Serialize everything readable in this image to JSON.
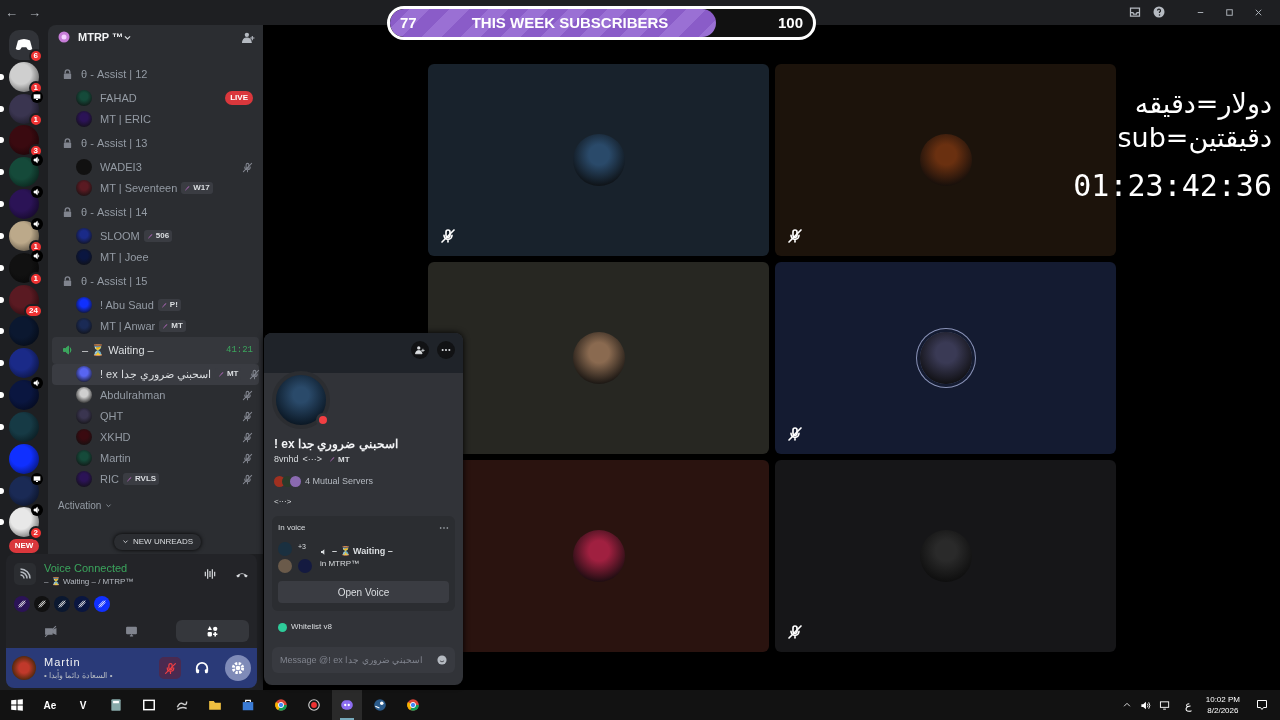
{
  "titlebar": {
    "back": "←",
    "forward": "→"
  },
  "subscriber_goal": {
    "current": "77",
    "label": "THIS WEEK SUBSCRIBERS",
    "target": "100",
    "level": 0.77
  },
  "servers": [
    {
      "kind": "home",
      "badge": "6",
      "unread": false,
      "voice": false,
      "screen": false
    },
    {
      "kind": "server",
      "badge": "1",
      "unread": true,
      "voice": false,
      "screen": false
    },
    {
      "kind": "server",
      "badge": "1",
      "unread": true,
      "voice": false,
      "screen": true
    },
    {
      "kind": "server",
      "badge": "3",
      "unread": true,
      "voice": false,
      "screen": false
    },
    {
      "kind": "server",
      "unread": true,
      "voice": true,
      "screen": false
    },
    {
      "kind": "server",
      "unread": true,
      "voice": true,
      "screen": false
    },
    {
      "kind": "server",
      "badge": "1",
      "unread": true,
      "voice": true,
      "screen": false
    },
    {
      "kind": "server",
      "badge": "1",
      "unread": true,
      "voice": true,
      "screen": false
    },
    {
      "kind": "server",
      "badge": "24",
      "unread": true,
      "voice": false,
      "screen": false
    },
    {
      "kind": "server",
      "unread": true,
      "voice": false,
      "screen": false
    },
    {
      "kind": "server",
      "unread": true,
      "voice": false,
      "screen": false
    },
    {
      "kind": "server",
      "unread": true,
      "voice": true,
      "screen": false
    },
    {
      "kind": "server",
      "unread": true,
      "voice": false,
      "screen": false
    },
    {
      "kind": "server",
      "unread": false,
      "voice": false,
      "screen": false
    },
    {
      "kind": "server",
      "unread": true,
      "voice": false,
      "screen": true
    },
    {
      "kind": "server",
      "badge": "2",
      "unread": true,
      "voice": true,
      "screen": false
    }
  ],
  "new_pill": "NEW",
  "channel_list": {
    "server_name": "MTRP ™",
    "channels": [
      {
        "name": "θ - Assist | 12",
        "locked": true,
        "connected": false,
        "members": [
          {
            "name": "FAHAD",
            "badge": "LIVE",
            "muted": false,
            "selected": false
          },
          {
            "name": "MT | ERIC",
            "muted": false,
            "selected": false
          }
        ]
      },
      {
        "name": "θ - Assist | 13",
        "locked": true,
        "connected": false,
        "members": [
          {
            "name": "WADEI3",
            "muted": true,
            "selected": false
          },
          {
            "name": "MT | Seventeen",
            "tag": "W17",
            "muted": false,
            "selected": false
          }
        ]
      },
      {
        "name": "θ - Assist | 14",
        "locked": true,
        "connected": false,
        "members": [
          {
            "name": "SLOOM",
            "tag": "506",
            "muted": false,
            "selected": false
          },
          {
            "name": "MT | Joee",
            "muted": false,
            "selected": false
          }
        ]
      },
      {
        "name": "θ - Assist | 15",
        "locked": true,
        "connected": false,
        "members": [
          {
            "name": "! Abu Saud",
            "tag": "P!",
            "muted": false,
            "selected": false
          },
          {
            "name": "MT | Anwar",
            "tag": "MT",
            "muted": false,
            "selected": false
          }
        ]
      },
      {
        "name": "– ⏳ Waiting –",
        "locked": false,
        "connected": true,
        "duration": "41:21",
        "members": [
          {
            "name": "! ex اسحبني ضروري جدا",
            "tag": "MT",
            "muted": true,
            "selected": true
          },
          {
            "name": "Abdulrahman",
            "muted": true,
            "selected": false
          },
          {
            "name": "QHT",
            "muted": true,
            "selected": false
          },
          {
            "name": "XKHD",
            "muted": true,
            "selected": false
          },
          {
            "name": "Martin",
            "muted": true,
            "selected": false
          },
          {
            "name": "RIC",
            "tag": "RVLS",
            "muted": true,
            "selected": false
          }
        ]
      }
    ],
    "category": "Activation",
    "unreads_pill": "NEW UNREADS"
  },
  "voice_panel": {
    "status": "Voice Connected",
    "location": "– ⏳ Waiting – / MTRP™",
    "participants": [
      {
        "muted": true
      },
      {
        "muted": true
      },
      {
        "muted": true
      },
      {
        "muted": true
      },
      {
        "muted": true
      }
    ],
    "controls": [
      {
        "kind": "camera",
        "selected": false
      },
      {
        "kind": "screen",
        "selected": false
      },
      {
        "kind": "activities",
        "selected": true
      }
    ]
  },
  "user_panel": {
    "name": "Martin",
    "status": "• السعادة دائما وأبدا •",
    "mic_muted": true
  },
  "profile_popup": {
    "display_name": "! ex اسحبني ضروري جدا",
    "username": "8vnhd",
    "pronouns": "<···>",
    "tag": "MT",
    "mutual_servers": "4 Mutual Servers",
    "bio": "<···>",
    "in_voice": {
      "heading": "In voice",
      "extra": "+3",
      "channel": "– ⏳ Waiting –",
      "server": "in MTRP™",
      "button": "Open Voice"
    },
    "role": {
      "name": "Whitelist v8",
      "color": "#2ecc9a"
    },
    "message_placeholder": "Message @! ex اسحبني ضروري جدا"
  },
  "video_tiles": [
    {
      "color": "#18222c",
      "muted": true,
      "ring": false
    },
    {
      "color": "#1c130b",
      "muted": true,
      "ring": false
    },
    {
      "color": "#272722",
      "muted": false,
      "ring": false
    },
    {
      "color": "#141b31",
      "muted": true,
      "ring": true
    },
    {
      "color": "#2a130f",
      "muted": false,
      "ring": false
    },
    {
      "color": "#161618",
      "muted": true,
      "ring": false
    }
  ],
  "overlay": {
    "lines": [
      "دولار=دقيقه",
      "sub=دقيقتين"
    ],
    "countdown": "01:23:42:36"
  },
  "taskbar": {
    "apps": [
      {
        "kind": "start",
        "selected": false
      },
      {
        "kind": "text",
        "label": "Ae",
        "selected": false
      },
      {
        "kind": "text",
        "label": "V",
        "selected": false
      },
      {
        "kind": "calculator",
        "selected": false
      },
      {
        "kind": "window",
        "selected": false
      },
      {
        "kind": "swirl",
        "selected": false
      },
      {
        "kind": "folder",
        "selected": false
      },
      {
        "kind": "store",
        "selected": false
      },
      {
        "kind": "browser",
        "selected": false
      },
      {
        "kind": "record",
        "selected": false
      },
      {
        "kind": "chat",
        "selected": true
      },
      {
        "kind": "steam",
        "selected": false
      },
      {
        "kind": "browser",
        "selected": false
      }
    ],
    "language": "ع",
    "time": "10:02 PM",
    "date": "8/2/2026"
  }
}
